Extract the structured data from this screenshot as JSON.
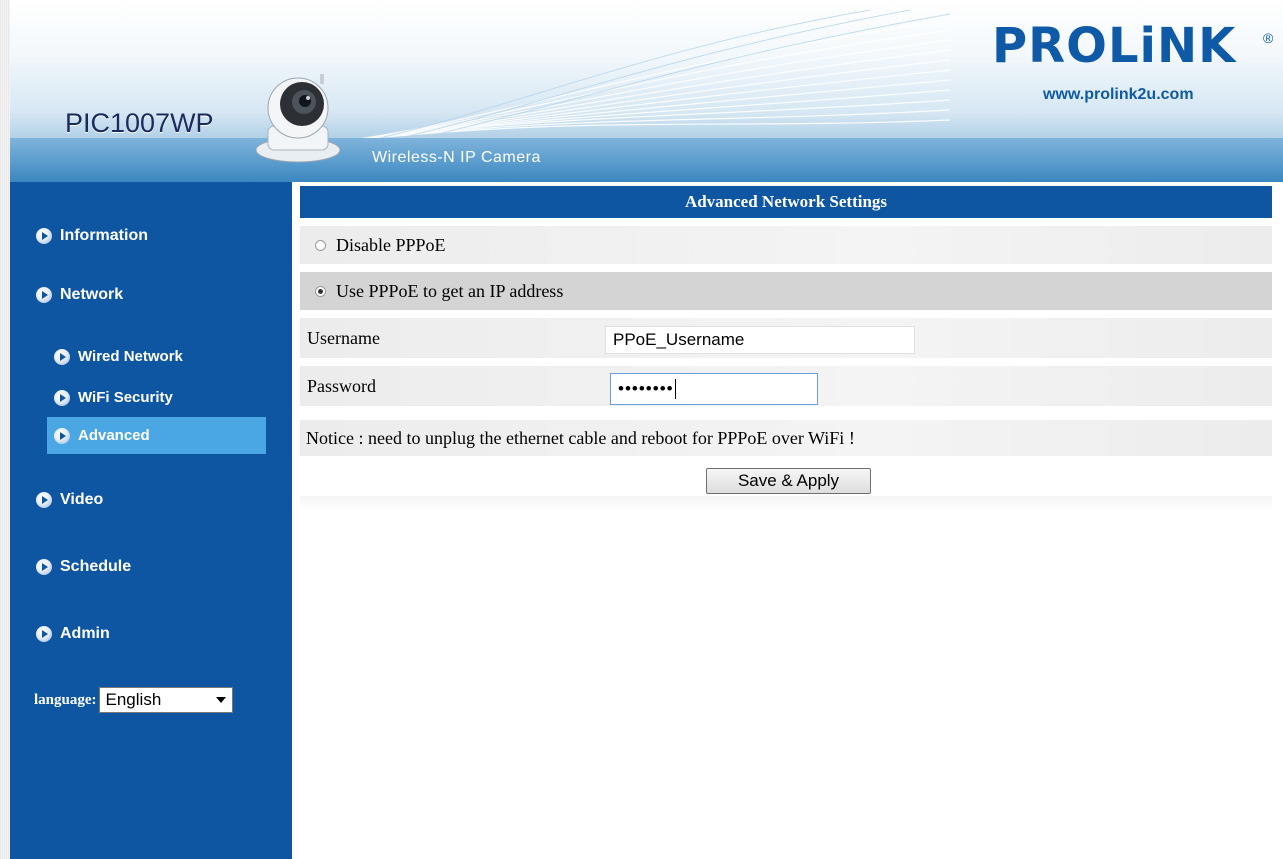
{
  "header": {
    "model": "PIC1007WP",
    "subtitle": "Wireless-N IP Camera",
    "brand": "PROLiNK",
    "brand_mark": "®",
    "website": "www.prolink2u.com"
  },
  "sidebar": {
    "items": [
      {
        "label": "Information",
        "icon": "arrow-bullet-icon"
      },
      {
        "label": "Network",
        "icon": "arrow-bullet-icon"
      },
      {
        "label": "Wired Network",
        "icon": "arrow-bullet-icon"
      },
      {
        "label": "WiFi Security",
        "icon": "arrow-bullet-icon"
      },
      {
        "label": "Advanced",
        "icon": "arrow-bullet-icon",
        "active": true
      },
      {
        "label": "Video",
        "icon": "arrow-bullet-icon"
      },
      {
        "label": "Schedule",
        "icon": "arrow-bullet-icon"
      },
      {
        "label": "Admin",
        "icon": "arrow-bullet-icon"
      }
    ],
    "language_label": "language:",
    "language_value": "English"
  },
  "main": {
    "title": "Advanced Network Settings",
    "option_disable": "Disable PPPoE",
    "option_use": "Use PPPoE to get an IP address",
    "selected_option": "Use PPPoE to get an IP address",
    "username_label": "Username",
    "username_value": "PPoE_Username",
    "password_label": "Password",
    "password_value": "••••••••",
    "notice": "Notice : need to unplug the ethernet cable and reboot for PPPoE over WiFi !",
    "save_label": "Save & Apply"
  },
  "colors": {
    "sidebar_bg": "#0e56a2",
    "active_item": "#4aa7e4",
    "brand": "#0f5aa6"
  }
}
